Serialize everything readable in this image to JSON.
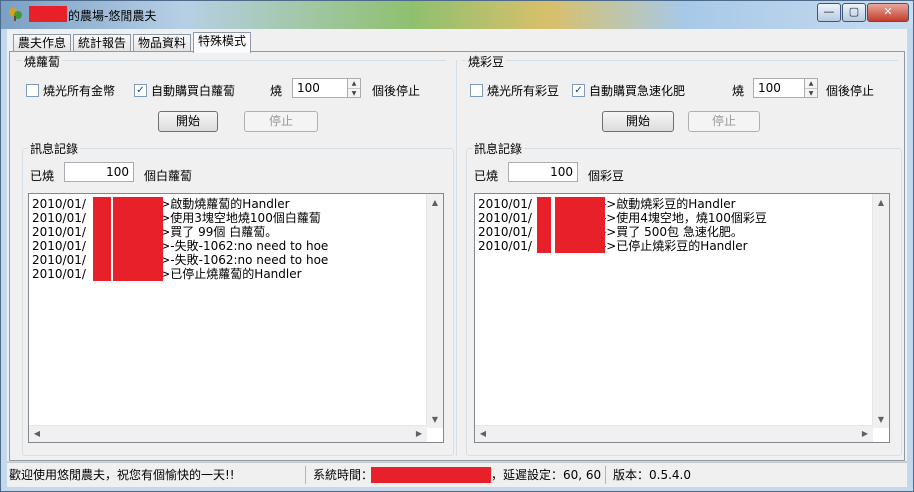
{
  "window": {
    "title_suffix": "的農場-悠閒農夫",
    "minimize": "—",
    "maximize": "▢",
    "close": "✕"
  },
  "tabs": [
    {
      "label": "農夫作息"
    },
    {
      "label": "統計報告"
    },
    {
      "label": "物品資料"
    },
    {
      "label": "特殊模式"
    }
  ],
  "active_tab": "特殊模式",
  "left": {
    "group_title": "燒蘿蔔",
    "burn_all_label": "燒光所有金幣",
    "burn_all_checked": false,
    "auto_buy_label": "自動購買白蘿蔔",
    "auto_buy_checked": true,
    "burn_prefix": "燒",
    "burn_count": "100",
    "burn_suffix": "個後停止",
    "start_button": "開始",
    "stop_button": "停止",
    "log_title": "訊息記錄",
    "burned_prefix": "已燒",
    "burned_value": "100",
    "burned_suffix": "個白蘿蔔",
    "log_lines": [
      {
        "date": "2010/01/",
        "msg": "->啟動燒蘿蔔的Handler"
      },
      {
        "date": "2010/01/",
        "msg": "->使用3塊空地燒100個白蘿蔔"
      },
      {
        "date": "2010/01/",
        "msg": "->買了 99個 白蘿蔔。"
      },
      {
        "date": "2010/01/",
        "msg": "->-失敗-1062:no need to hoe"
      },
      {
        "date": "2010/01/",
        "msg": "->-失敗-1062:no need to hoe"
      },
      {
        "date": "2010/01/",
        "msg": "->已停止燒蘿蔔的Handler"
      }
    ]
  },
  "right": {
    "group_title": "燒彩豆",
    "burn_all_label": "燒光所有彩豆",
    "burn_all_checked": false,
    "auto_buy_label": "自動購買急速化肥",
    "auto_buy_checked": true,
    "burn_prefix": "燒",
    "burn_count": "100",
    "burn_suffix": "個後停止",
    "start_button": "開始",
    "stop_button": "停止",
    "log_title": "訊息記錄",
    "burned_prefix": "已燒",
    "burned_value": "100",
    "burned_suffix": "個彩豆",
    "log_lines": [
      {
        "date": "2010/01/",
        "msg": "->啟動燒彩豆的Handler"
      },
      {
        "date": "2010/01/",
        "msg": "->使用4塊空地，燒100個彩豆"
      },
      {
        "date": "2010/01/",
        "msg": "->買了 500包 急速化肥。"
      },
      {
        "date": "2010/01/",
        "msg": "->已停止燒彩豆的Handler"
      }
    ]
  },
  "status": {
    "welcome": "歡迎使用悠閒農夫，祝您有個愉快的一天!!",
    "time_label": "系統時間：",
    "delay_text": "，延遲設定：60, 60",
    "version_text": "版本：0.5.4.0"
  },
  "colors": {
    "redaction": "#e8202a",
    "check_mark": "#1a3a8a"
  }
}
